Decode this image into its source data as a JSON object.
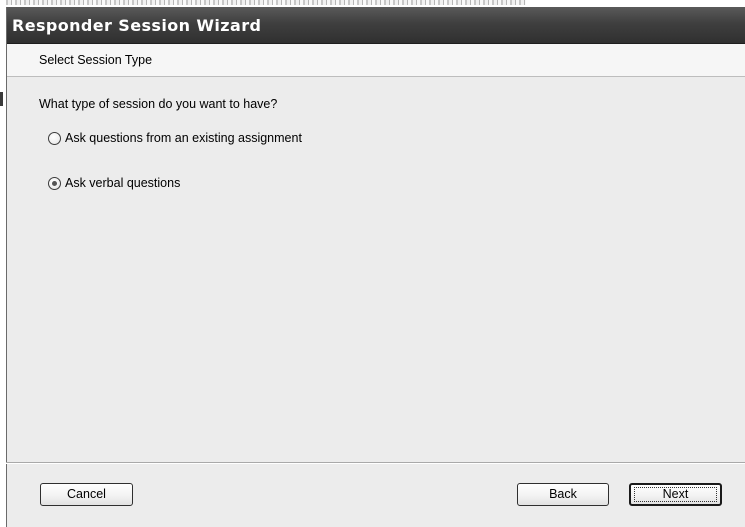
{
  "window": {
    "title": "Responder Session Wizard"
  },
  "header": {
    "step_title": "Select Session Type"
  },
  "content": {
    "question": "What type of session do you want to have?",
    "options": [
      {
        "label": "Ask questions from an existing assignment",
        "selected": false
      },
      {
        "label": "Ask verbal questions",
        "selected": true
      }
    ]
  },
  "buttons": {
    "cancel": "Cancel",
    "back": "Back",
    "next": "Next"
  }
}
